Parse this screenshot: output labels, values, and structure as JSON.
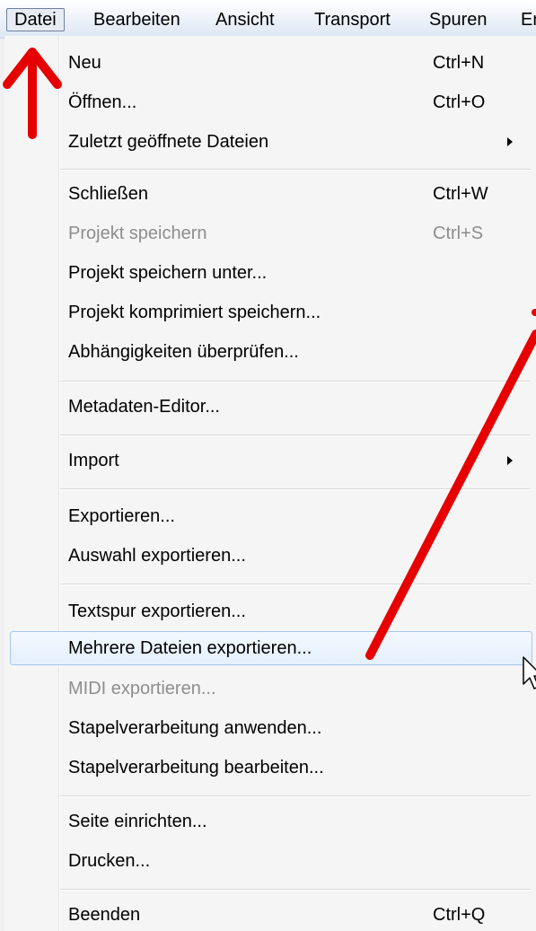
{
  "menubar": {
    "items": [
      "Datei",
      "Bearbeiten",
      "Ansicht",
      "Transport",
      "Spuren",
      "Er"
    ]
  },
  "menu": {
    "items": [
      {
        "label": "Neu",
        "shortcut": "Ctrl+N"
      },
      {
        "label": "Öffnen...",
        "shortcut": "Ctrl+O"
      },
      {
        "label": "Zuletzt geöffnete Dateien",
        "submenu": true
      },
      {
        "label": "Schließen",
        "shortcut": "Ctrl+W"
      },
      {
        "label": "Projekt speichern",
        "shortcut": "Ctrl+S",
        "disabled": true
      },
      {
        "label": "Projekt speichern unter..."
      },
      {
        "label": "Projekt komprimiert speichern..."
      },
      {
        "label": "Abhängigkeiten überprüfen..."
      },
      {
        "label": "Metadaten-Editor..."
      },
      {
        "label": "Import",
        "submenu": true
      },
      {
        "label": "Exportieren..."
      },
      {
        "label": "Auswahl exportieren..."
      },
      {
        "label": "Textspur exportieren..."
      },
      {
        "label": "Mehrere Dateien exportieren...",
        "highlighted": true
      },
      {
        "label": "MIDI exportieren...",
        "disabled": true
      },
      {
        "label": "Stapelverarbeitung anwenden..."
      },
      {
        "label": "Stapelverarbeitung bearbeiten..."
      },
      {
        "label": "Seite einrichten..."
      },
      {
        "label": "Drucken..."
      },
      {
        "label": "Beenden",
        "shortcut": "Ctrl+Q"
      }
    ]
  },
  "colors": {
    "annotation_arrow": "#e60000",
    "highlight_border": "#a8c8ec",
    "disabled_text": "#8d8d8d"
  }
}
